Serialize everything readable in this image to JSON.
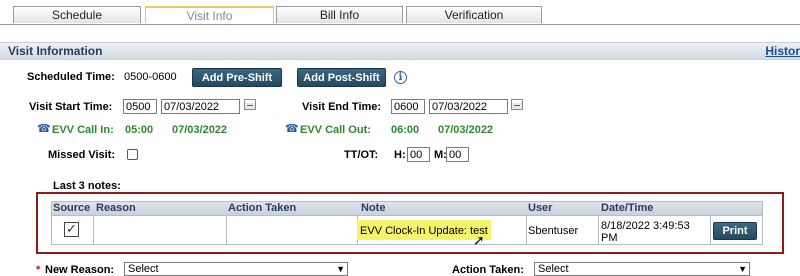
{
  "tabs": [
    {
      "label": "Schedule"
    },
    {
      "label": "Visit Info"
    },
    {
      "label": "Bill Info"
    },
    {
      "label": "Verification"
    }
  ],
  "section": {
    "title": "Visit Information",
    "history_link": "Histor"
  },
  "scheduled": {
    "label": "Scheduled Time:",
    "value": "0500-0600"
  },
  "buttons": {
    "pre_shift": "Add Pre-Shift",
    "post_shift": "Add Post-Shift",
    "print": "Print"
  },
  "visit_start": {
    "label": "Visit Start Time:",
    "time": "0500",
    "date": "07/03/2022"
  },
  "visit_end": {
    "label": "Visit End Time:",
    "time": "0600",
    "date": "07/03/2022"
  },
  "evv_in": {
    "label": "EVV Call In:",
    "time": "05:00",
    "date": "07/03/2022"
  },
  "evv_out": {
    "label": "EVV Call Out:",
    "time": "06:00",
    "date": "07/03/2022"
  },
  "missed_visit": {
    "label": "Missed Visit:",
    "checked": false
  },
  "ttot": {
    "label": "TT/OT:",
    "h_label": "H:",
    "h_value": "00",
    "m_label": "M:",
    "m_value": "00"
  },
  "notes": {
    "title": "Last 3 notes:",
    "columns": [
      "Source",
      "Reason",
      "Action Taken",
      "Note",
      "User",
      "Date/Time"
    ],
    "rows": [
      {
        "reason": "",
        "action_taken": "",
        "note": "EVV Clock-In Update: test",
        "user": "Sbentuser",
        "datetime_line1": "8/18/2022 3:49:53",
        "datetime_line2": "PM"
      }
    ]
  },
  "bottom": {
    "new_reason_label": "New Reason:",
    "new_reason_value": "Select",
    "action_taken_label": "Action Taken:",
    "action_taken_value": "Select",
    "required_mark": "*"
  },
  "colors": {
    "accent_blue": "#234a5f",
    "evv_green": "#2c8a2c",
    "notes_border": "#8f1a1a",
    "highlight": "#f5f36a"
  }
}
